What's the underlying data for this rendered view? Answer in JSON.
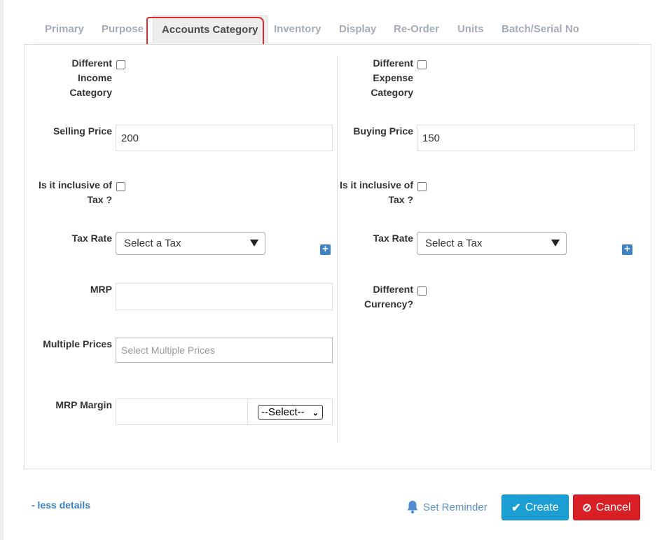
{
  "tabs": [
    {
      "label": "Primary"
    },
    {
      "label": "Purpose"
    },
    {
      "label": "Accounts Category",
      "active": true
    },
    {
      "label": "Inventory"
    },
    {
      "label": "Display"
    },
    {
      "label": "Re-Order"
    },
    {
      "label": "Units"
    },
    {
      "label": "Batch/Serial No"
    }
  ],
  "left": {
    "diff_income_label": "Different Income Category",
    "selling_price_label": "Selling Price",
    "selling_price_value": "200",
    "inclusive_tax_label": "Is it inclusive of Tax ?",
    "tax_rate_label": "Tax Rate",
    "tax_rate_selected": "Select a Tax",
    "mrp_label": "MRP",
    "mrp_value": "",
    "multiple_prices_label": "Multiple Prices",
    "multiple_prices_placeholder": "Select Multiple Prices",
    "mrp_margin_label": "MRP Margin",
    "mrp_margin_value": "",
    "mrp_margin_select": "--Select--"
  },
  "right": {
    "diff_expense_label": "Different Expense Category",
    "buying_price_label": "Buying Price",
    "buying_price_value": "150",
    "inclusive_tax_label": "Is it inclusive of Tax ?",
    "tax_rate_label": "Tax Rate",
    "tax_rate_selected": "Select a Tax",
    "diff_currency_label": "Different Currency?"
  },
  "footer": {
    "less_details": "- less details",
    "set_reminder": "Set Reminder",
    "create": "Create",
    "cancel": "Cancel"
  },
  "colors": {
    "accent": "#1a9ed3",
    "danger": "#d71f25",
    "link": "#3a7fc0",
    "tab_inactive": "#a3acb5",
    "highlight": "#dd2a2a"
  },
  "icons": [
    "plus-square-icon",
    "bell-icon",
    "check-icon",
    "ban-icon",
    "caret-down-icon"
  ]
}
